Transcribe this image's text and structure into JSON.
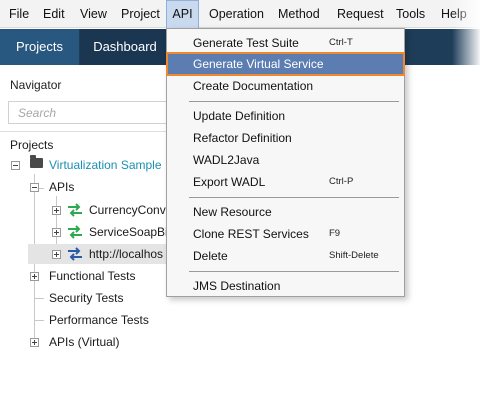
{
  "menubar": {
    "items": [
      {
        "label": "File"
      },
      {
        "label": "Edit"
      },
      {
        "label": "View"
      },
      {
        "label": "Project"
      },
      {
        "label": "API"
      },
      {
        "label": "Operation"
      },
      {
        "label": "Method"
      },
      {
        "label": "Request"
      },
      {
        "label": "Tools"
      },
      {
        "label": "Help"
      }
    ],
    "active": "API"
  },
  "toolbar": {
    "tabs": [
      {
        "label": "Projects"
      },
      {
        "label": "Dashboard"
      }
    ]
  },
  "navigator": {
    "title": "Navigator",
    "search_placeholder": "Search",
    "tree": {
      "header": "Projects",
      "project": "Virtualization Sample",
      "apis_folder": "APIs",
      "services": [
        {
          "label": "CurrencyConve",
          "icon": "green-arrows-icon"
        },
        {
          "label": "ServiceSoapBin",
          "icon": "green-arrows-icon"
        },
        {
          "label": "http://localhos",
          "icon": "blue-arrows-icon"
        }
      ],
      "functional_tests": "Functional Tests",
      "security_tests": "Security Tests",
      "performance_tests": "Performance Tests",
      "apis_virtual": "APIs (Virtual)"
    }
  },
  "dropdown": {
    "items": [
      {
        "label": "Generate Test Suite",
        "shortcut": "Ctrl-T"
      },
      {
        "label": "Generate Virtual Service",
        "shortcut": "",
        "highlighted": true
      },
      {
        "label": "Create Documentation",
        "shortcut": ""
      },
      {
        "label": "Update Definition",
        "shortcut": ""
      },
      {
        "label": "Refactor Definition",
        "shortcut": ""
      },
      {
        "label": "WADL2Java",
        "shortcut": ""
      },
      {
        "label": "Export WADL",
        "shortcut": "Ctrl-P"
      },
      {
        "label": "New Resource",
        "shortcut": ""
      },
      {
        "label": "Clone REST Services",
        "shortcut": "F9"
      },
      {
        "label": "Delete",
        "shortcut": "Shift-Delete"
      },
      {
        "label": "JMS Destination",
        "shortcut": ""
      }
    ]
  },
  "colors": {
    "toolbar": "#1e3d59",
    "projects_tab": "#28587f",
    "highlight": "#5b7db1",
    "highlight_border": "#f0892e",
    "project_link": "#1b8fb1",
    "green_icon": "#2fa84f",
    "blue_icon": "#2a5aa8"
  }
}
